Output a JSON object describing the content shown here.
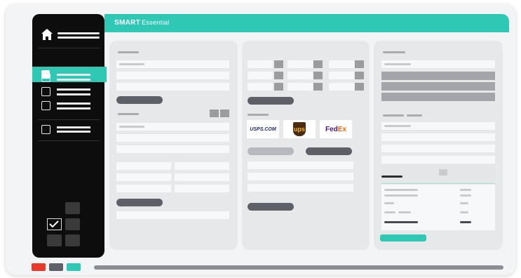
{
  "app": {
    "brand": "SMART",
    "edition": "Essential"
  },
  "colors": {
    "accent": "#2ec8b5",
    "sidebar": "#0d0d0d",
    "red": "#e8392b",
    "slate": "#5d6068"
  },
  "sidebar": {
    "home_icon": "home-icon",
    "items": [
      "active",
      "item-1",
      "item-2",
      "item-3",
      "item-4"
    ]
  },
  "carriers": {
    "usps": "USPS.COM",
    "ups": "ups",
    "fedex_fe": "Fed",
    "fedex_ex": "Ex"
  },
  "bottom_dots": [
    "red",
    "slate",
    "teal"
  ]
}
